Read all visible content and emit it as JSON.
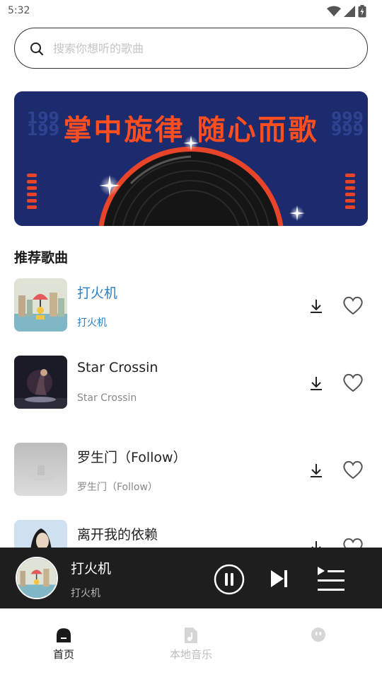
{
  "status_bar": {
    "time": "5:32",
    "icons": [
      "wifi-icon",
      "cell-signal-icon",
      "battery-icon"
    ]
  },
  "search": {
    "placeholder": "搜索你想听的歌曲",
    "icon": "search-icon"
  },
  "banner": {
    "headline": "掌中旋律 随心而歌",
    "background_color": "#1c2a6e",
    "text_color": "#ff4e1f"
  },
  "section": {
    "title": "推荐歌曲"
  },
  "songs": [
    {
      "title": "打火机",
      "artist": "打火机",
      "playing": true
    },
    {
      "title": "Star Crossin",
      "artist": "Star Crossin",
      "playing": false
    },
    {
      "title": "罗生门（Follow）",
      "artist": "罗生门（Follow）",
      "playing": false
    },
    {
      "title": "离开我的依赖",
      "artist": "",
      "playing": false
    }
  ],
  "now_playing": {
    "title": "打火机",
    "artist": "打火机",
    "state": "playing"
  },
  "bottom_nav": [
    {
      "label": "首页",
      "icon": "home-icon",
      "active": true
    },
    {
      "label": "本地音乐",
      "icon": "local-music-icon",
      "active": false
    },
    {
      "label": "",
      "icon": "profile-icon",
      "active": false
    }
  ],
  "colors": {
    "accent": "#2a7fc4",
    "player_bg": "#1e1e1e"
  }
}
